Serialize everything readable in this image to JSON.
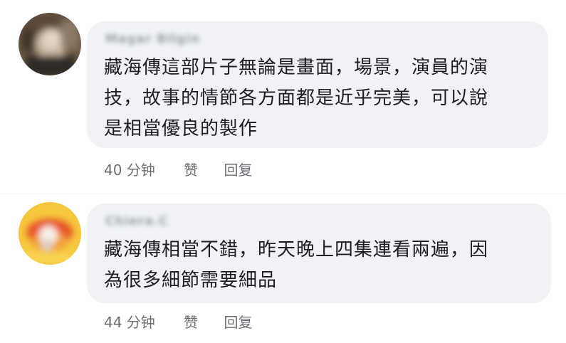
{
  "comments": [
    {
      "author": "Magar Bilgin",
      "avatar_icon": "blurred-photo-avatar",
      "text_lines": [
        "藏海傳這部片子無論是畫面，場景，演員的演",
        "技，故事的情節各方面都是近乎完美，可以說",
        "是相當優良的製作"
      ],
      "time": "40 分钟",
      "like": "赞",
      "reply": "回复"
    },
    {
      "author": "Chiera.C",
      "avatar_icon": "blurred-cartoon-avatar",
      "text_lines": [
        "藏海傳相當不錯，昨天晚上四集連看兩遍，因",
        "為很多細節需要細品"
      ],
      "time": "44 分钟",
      "like": "赞",
      "reply": "回复"
    }
  ],
  "colors": {
    "bubble": "#f0f2f5",
    "text": "#1c1e21",
    "meta": "#6b6e73"
  }
}
